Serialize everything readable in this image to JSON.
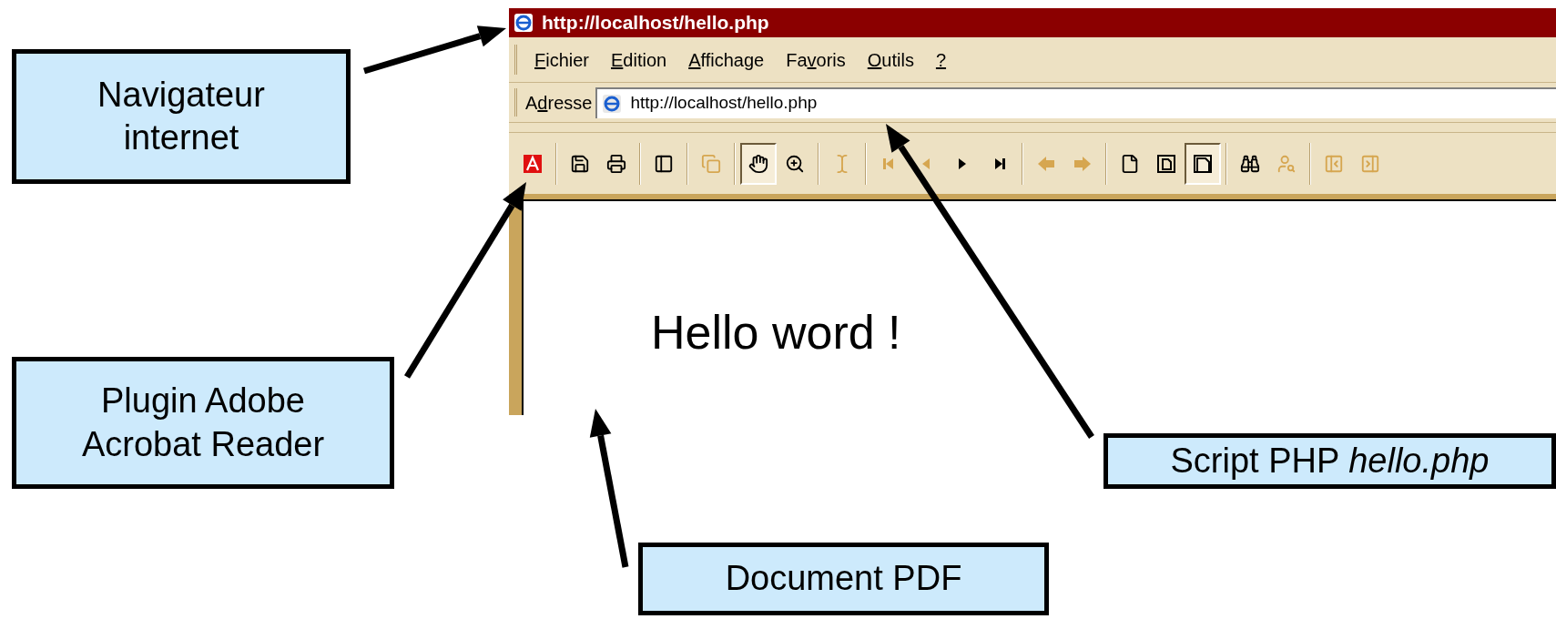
{
  "browser": {
    "title": "http://localhost/hello.php",
    "menu": [
      {
        "key": "F",
        "after": "ichier"
      },
      {
        "key": "E",
        "after": "dition"
      },
      {
        "key": "A",
        "after": "ffichage"
      },
      {
        "before": "Fa",
        "key": "v",
        "after": "oris"
      },
      {
        "key": "O",
        "after": "utils"
      },
      {
        "key": "?"
      }
    ],
    "address": {
      "label": {
        "before": "A",
        "key": "d",
        "after": "resse"
      },
      "value": "http://localhost/hello.php"
    },
    "toolbar": [
      {
        "kind": "acrobat",
        "disabled": false,
        "selected": false
      },
      {
        "kind": "separator"
      },
      {
        "kind": "save",
        "disabled": false,
        "selected": false
      },
      {
        "kind": "print",
        "disabled": false,
        "selected": false
      },
      {
        "kind": "separator"
      },
      {
        "kind": "panel",
        "disabled": false,
        "selected": false
      },
      {
        "kind": "separator"
      },
      {
        "kind": "copy",
        "disabled": true,
        "selected": false
      },
      {
        "kind": "separator"
      },
      {
        "kind": "hand",
        "disabled": false,
        "selected": true
      },
      {
        "kind": "zoom",
        "disabled": false,
        "selected": false
      },
      {
        "kind": "separator"
      },
      {
        "kind": "text",
        "disabled": true,
        "selected": false
      },
      {
        "kind": "separator"
      },
      {
        "kind": "first",
        "disabled": true,
        "selected": false
      },
      {
        "kind": "prev",
        "disabled": true,
        "selected": false
      },
      {
        "kind": "next",
        "disabled": false,
        "selected": false
      },
      {
        "kind": "last",
        "disabled": false,
        "selected": false
      },
      {
        "kind": "separator"
      },
      {
        "kind": "back",
        "disabled": true,
        "selected": false
      },
      {
        "kind": "forward",
        "disabled": true,
        "selected": false
      },
      {
        "kind": "separator"
      },
      {
        "kind": "page",
        "disabled": false,
        "selected": false
      },
      {
        "kind": "fit",
        "disabled": false,
        "selected": false
      },
      {
        "kind": "width",
        "disabled": false,
        "selected": true
      },
      {
        "kind": "separator"
      },
      {
        "kind": "find",
        "disabled": false,
        "selected": false
      },
      {
        "kind": "search",
        "disabled": true,
        "selected": false
      },
      {
        "kind": "separator"
      },
      {
        "kind": "prev-doc",
        "disabled": true,
        "selected": false
      },
      {
        "kind": "next-doc",
        "disabled": true,
        "selected": false
      }
    ],
    "document": {
      "text": "Hello word !"
    }
  },
  "callouts": [
    {
      "text": "Navigateur internet"
    },
    {
      "text": "Plugin Adobe Acrobat Reader"
    },
    {
      "text": "Script PHP *hello.php*"
    },
    {
      "text": "Document PDF"
    }
  ]
}
